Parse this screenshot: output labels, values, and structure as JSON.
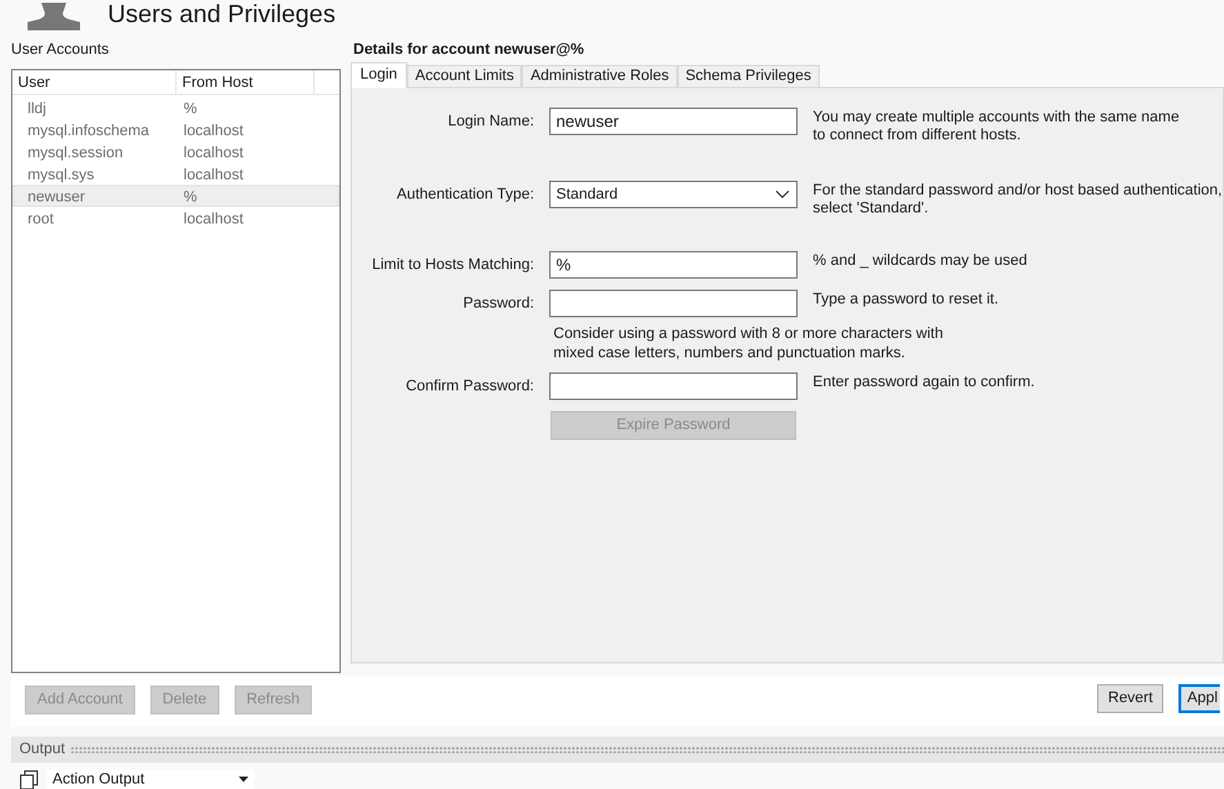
{
  "header": {
    "title": "Users and Privileges"
  },
  "accounts": {
    "label": "User Accounts",
    "columns": [
      "User",
      "From Host"
    ],
    "rows": [
      {
        "user": "lldj",
        "host": "%",
        "selected": false
      },
      {
        "user": "mysql.infoschema",
        "host": "localhost",
        "selected": false
      },
      {
        "user": "mysql.session",
        "host": "localhost",
        "selected": false
      },
      {
        "user": "mysql.sys",
        "host": "localhost",
        "selected": false
      },
      {
        "user": "newuser",
        "host": "%",
        "selected": true
      },
      {
        "user": "root",
        "host": "localhost",
        "selected": false
      }
    ]
  },
  "account_buttons": [
    {
      "label": "Add Account",
      "disabled": true
    },
    {
      "label": "Delete",
      "disabled": true
    },
    {
      "label": "Refresh",
      "disabled": true
    }
  ],
  "details": {
    "title": "Details for account newuser@%",
    "tabs": [
      {
        "label": "Login",
        "selected": true
      },
      {
        "label": "Account Limits",
        "selected": false
      },
      {
        "label": "Administrative Roles",
        "selected": false
      },
      {
        "label": "Schema Privileges",
        "selected": false
      }
    ],
    "fields": [
      {
        "kind": "text",
        "label": "Login Name:",
        "value": "newuser",
        "hint": "You may create multiple accounts with the same name\nto connect from different hosts."
      },
      {
        "kind": "select",
        "label": "Authentication Type:",
        "value": "Standard",
        "hint": "For the standard password and/or host based authentication,\nselect 'Standard'."
      },
      {
        "kind": "text",
        "label": "Limit to Hosts Matching:",
        "value": "%",
        "hint": "% and _ wildcards may be used"
      },
      {
        "kind": "password",
        "label": "Password:",
        "hint": "Type a password to reset it."
      },
      {
        "kind": "note",
        "text": "Consider using a password with 8 or more characters with\nmixed case letters, numbers and punctuation marks."
      },
      {
        "kind": "password",
        "label": "Confirm Password:",
        "hint": "Enter password again to confirm."
      },
      {
        "kind": "button",
        "label": "Expire Password",
        "disabled": true
      }
    ]
  },
  "footer_buttons": [
    {
      "label": "Revert",
      "focused": false
    },
    {
      "label": "Appl",
      "focused": true
    }
  ],
  "output": {
    "title": "Output",
    "selector": "Action Output"
  }
}
